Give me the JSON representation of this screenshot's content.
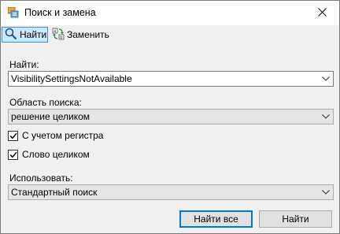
{
  "window": {
    "title": "Поиск и замена"
  },
  "toolbar": {
    "find_label": "Найти",
    "replace_label": "Заменить"
  },
  "find": {
    "label": "Найти:",
    "value": "VisibilitySettingsNotAvailable"
  },
  "scope": {
    "label": "Область поиска:",
    "value": "решение целиком"
  },
  "options": {
    "match_case_label": "С учетом регистра",
    "match_case_checked": true,
    "whole_word_label": "Слово целиком",
    "whole_word_checked": true
  },
  "use": {
    "label": "Использовать:",
    "value": "Стандартный поиск"
  },
  "buttons": {
    "find_all_label": "Найти все",
    "find_label": "Найти"
  },
  "icons": {
    "app": "find-replace-app-icon",
    "close": "close-icon",
    "search": "magnifier-icon",
    "replace": "replace-icon",
    "dropdown": "chevron-down-icon",
    "check": "checkmark-icon"
  },
  "colors": {
    "accent": "#0078d7",
    "active_tab_bg": "#cce8ff",
    "active_tab_border": "#3d8ee5",
    "window_bg": "#f0f0f0"
  }
}
